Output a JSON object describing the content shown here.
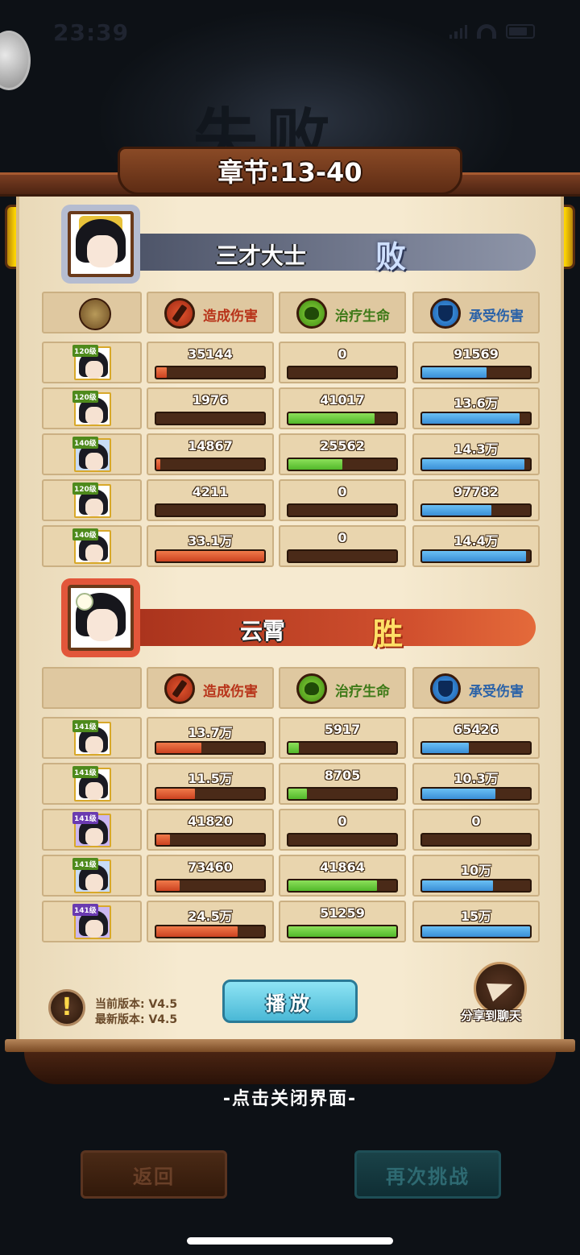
{
  "status_bar": {
    "time": "23:39"
  },
  "chapter": {
    "title": "章节:13-40"
  },
  "headers": {
    "damage": "造成伤害",
    "heal": "治疗生命",
    "taken": "承受伤害"
  },
  "teams": [
    {
      "name": "三才大士",
      "result": "败",
      "heroes": [
        {
          "level": "120级",
          "damage": "35144",
          "damage_fill": 0.1,
          "heal": "0",
          "heal_fill": 0,
          "taken": "91569",
          "taken_fill": 0.6
        },
        {
          "level": "120级",
          "damage": "1976",
          "damage_fill": 0,
          "heal": "41017",
          "heal_fill": 0.8,
          "taken": "13.6万",
          "taken_fill": 0.9
        },
        {
          "level": "140级",
          "damage": "14867",
          "damage_fill": 0.04,
          "heal": "25562",
          "heal_fill": 0.5,
          "taken": "14.3万",
          "taken_fill": 0.95
        },
        {
          "level": "120级",
          "damage": "4211",
          "damage_fill": 0,
          "heal": "0",
          "heal_fill": 0,
          "taken": "97782",
          "taken_fill": 0.64
        },
        {
          "level": "140级",
          "damage": "33.1万",
          "damage_fill": 1.0,
          "heal": "0",
          "heal_fill": 0,
          "taken": "14.4万",
          "taken_fill": 0.96
        }
      ]
    },
    {
      "name": "云霄",
      "result": "胜",
      "heroes": [
        {
          "level": "141级",
          "damage": "13.7万",
          "damage_fill": 0.42,
          "heal": "5917",
          "heal_fill": 0.1,
          "taken": "65426",
          "taken_fill": 0.43
        },
        {
          "level": "141级",
          "damage": "11.5万",
          "damage_fill": 0.36,
          "heal": "8705",
          "heal_fill": 0.17,
          "taken": "10.3万",
          "taken_fill": 0.68
        },
        {
          "level": "141级",
          "damage": "41820",
          "damage_fill": 0.13,
          "heal": "0",
          "heal_fill": 0,
          "taken": "0",
          "taken_fill": 0
        },
        {
          "level": "141级",
          "damage": "73460",
          "damage_fill": 0.22,
          "heal": "41864",
          "heal_fill": 0.82,
          "taken": "10万",
          "taken_fill": 0.66
        },
        {
          "level": "141级",
          "damage": "24.5万",
          "damage_fill": 0.75,
          "heal": "51259",
          "heal_fill": 1.0,
          "taken": "15万",
          "taken_fill": 1.0
        }
      ]
    }
  ],
  "version": {
    "current": "当前版本: V4.5",
    "latest": "最新版本: V4.5",
    "warning_icon": "!"
  },
  "buttons": {
    "play": "播放",
    "share": "分享到聊天",
    "back": "返回",
    "retry": "再次挑战"
  },
  "close_hint": "-点击关闭界面-",
  "colors": {
    "damage": "#cc4220",
    "heal": "#52b82a",
    "taken": "#3a8ed6"
  }
}
